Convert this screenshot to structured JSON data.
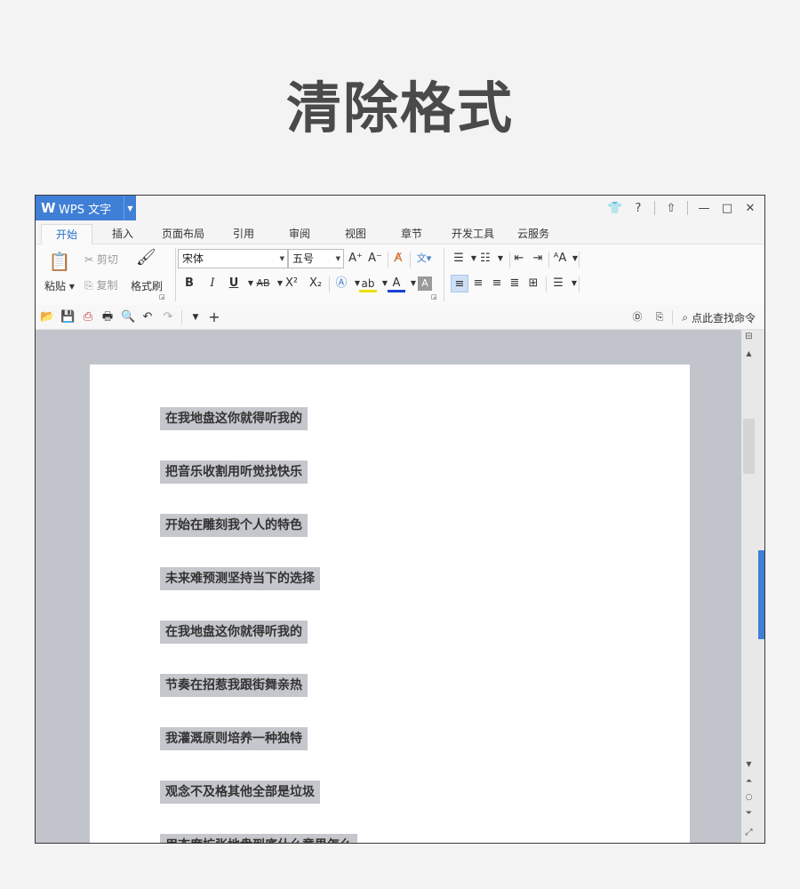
{
  "heading": "清除格式",
  "app": {
    "name": "WPS 文字"
  },
  "tabs": [
    "开始",
    "插入",
    "页面布局",
    "引用",
    "审阅",
    "视图",
    "章节",
    "开发工具",
    "云服务"
  ],
  "ribbon": {
    "paste": "粘贴",
    "cut": "剪切",
    "copy": "复制",
    "format_painter": "格式刷",
    "font_name": "宋体",
    "font_size": "五号",
    "bold": "B",
    "italic": "I",
    "underline": "U",
    "strike": "AB",
    "superscript": "X²",
    "subscript": "X₂",
    "grow_font": "A⁺",
    "shrink_font": "A⁻",
    "font_color_label": "A"
  },
  "quickbar": {
    "search_label": "点此查找命令"
  },
  "document": {
    "lines": [
      "在我地盘这你就得听我的",
      "把音乐收割用听觉找快乐",
      "开始在雕刻我个人的特色",
      "未来难预测坚持当下的选择",
      "在我地盘这你就得听我的",
      "节奏在招惹我跟街舞亲热",
      "我灌溉原则培养一种独特",
      "观念不及格其他全部是垃圾",
      "用态度扩张地盘到底什么意思怎么"
    ]
  },
  "colors": {
    "accent": "#3f7fd6",
    "highlight": "#c5c7cc"
  }
}
